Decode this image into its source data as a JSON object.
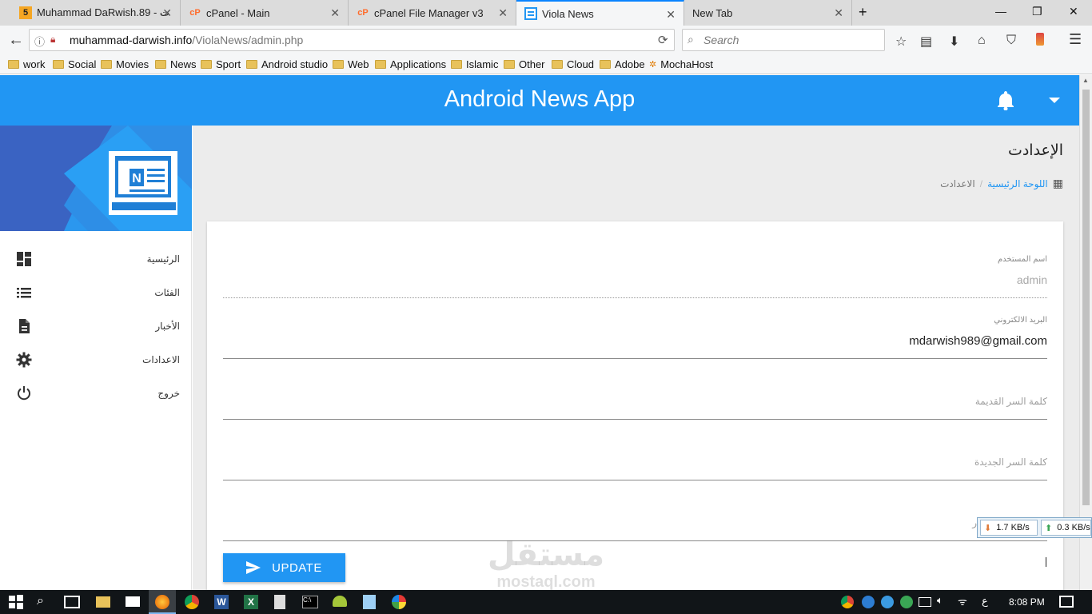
{
  "browser": {
    "tabs": [
      {
        "title": "Muhammad DaRwish.89 - ت",
        "favicon": "5"
      },
      {
        "title": "cPanel - Main",
        "favicon": "cP"
      },
      {
        "title": "cPanel File Manager v3",
        "favicon": "cP"
      },
      {
        "title": "Viola News",
        "favicon": "news"
      },
      {
        "title": "New Tab",
        "favicon": ""
      }
    ],
    "active_tab": 3,
    "url": "muhammad-darwish.info/ViolaNews/admin.php",
    "url_domain": "muhammad-darwish.info",
    "url_path": "/ViolaNews/admin.php",
    "search_placeholder": "Search",
    "bookmarks": [
      "work",
      "Social",
      "Movies",
      "News",
      "Sport",
      "Android studio",
      "Web",
      "Applications",
      "Islamic",
      "Other",
      "Cloud",
      "Adobe",
      "MochaHost"
    ]
  },
  "app": {
    "title": "Android News App",
    "header_icons": [
      "bell-icon",
      "caret-down-icon"
    ],
    "accent": "#2196f3",
    "sidebar": {
      "items": [
        {
          "label": "الرئيسية",
          "icon": "dashboard-icon"
        },
        {
          "label": "الفئات",
          "icon": "list-icon"
        },
        {
          "label": "الأخبار",
          "icon": "document-icon"
        },
        {
          "label": "الاعدادات",
          "icon": "gear-icon"
        },
        {
          "label": "خروج",
          "icon": "power-icon"
        }
      ]
    },
    "page_title": "الإعدادت",
    "breadcrumb": {
      "home": "اللوحة الرئيسية",
      "current": "الاعدادت"
    },
    "form": {
      "username_label": "اسم المستخدم",
      "username_value": "admin",
      "email_label": "البريد الالكتروني",
      "email_value": "mdarwish989@gmail.com",
      "old_password_placeholder": "كلمة السر القديمة",
      "new_password_placeholder": "كلمة السر الجديدة",
      "confirm_password_partial": "ر",
      "update_label": "UPDATE"
    }
  },
  "net_meter": {
    "down": "1.7 KB/s",
    "up": "0.3 KB/s"
  },
  "watermark": {
    "arabic": "مستقل",
    "latin": "mostaql.com"
  },
  "taskbar": {
    "time": "8:08 PM",
    "lang": "ع"
  }
}
